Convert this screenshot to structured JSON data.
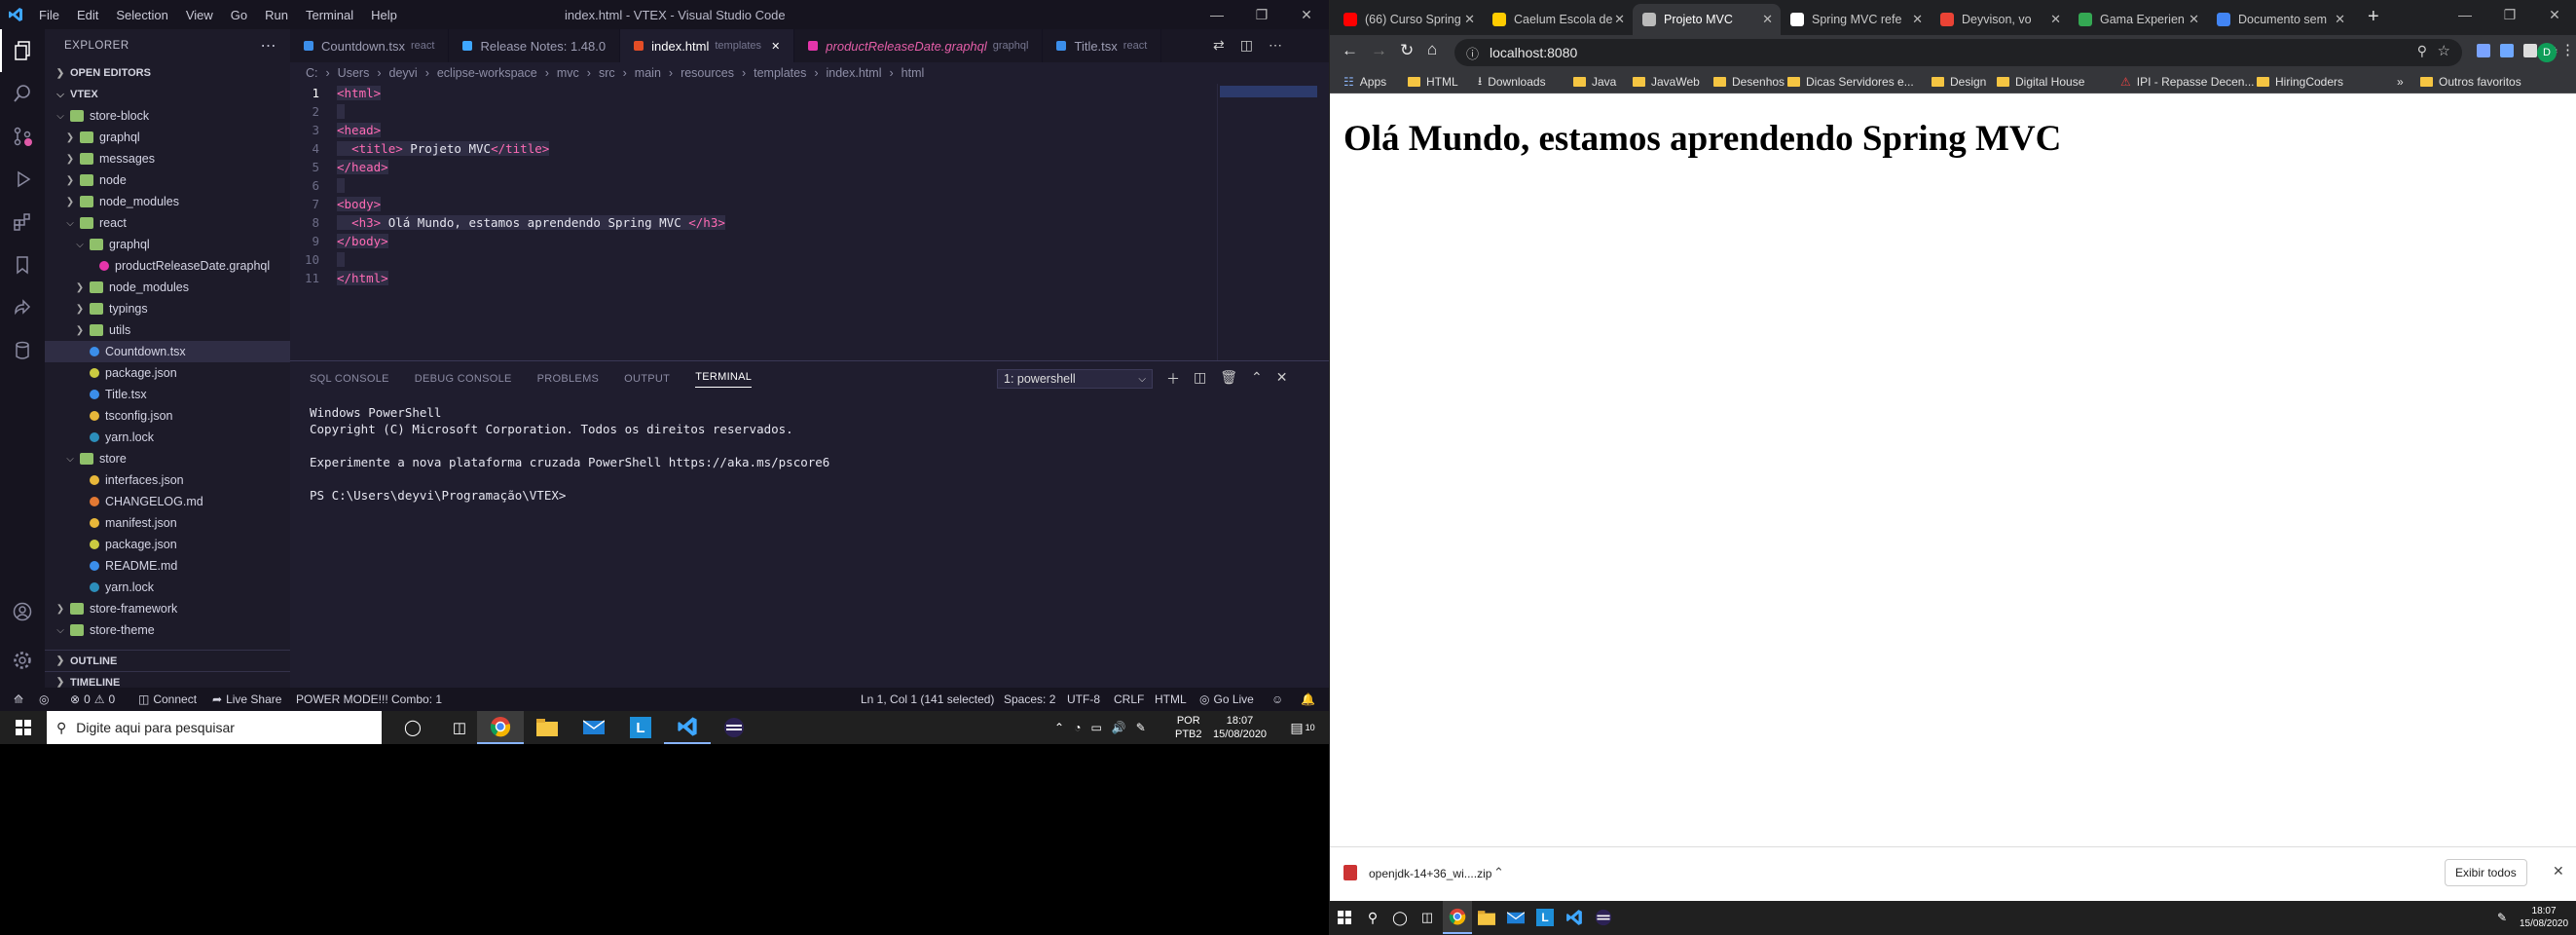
{
  "vscode": {
    "window_title": "index.html - VTEX - Visual Studio Code",
    "menu": [
      "File",
      "Edit",
      "Selection",
      "View",
      "Go",
      "Run",
      "Terminal",
      "Help"
    ],
    "explorer_title": "EXPLORER",
    "sections": {
      "open_editors": "OPEN EDITORS",
      "root": "VTEX",
      "outline": "OUTLINE",
      "timeline": "TIMELINE"
    },
    "tree": [
      {
        "label": "store-block",
        "depth": 0,
        "type": "folder-open"
      },
      {
        "label": "graphql",
        "depth": 1,
        "type": "folder"
      },
      {
        "label": "messages",
        "depth": 1,
        "type": "folder"
      },
      {
        "label": "node",
        "depth": 1,
        "type": "folder"
      },
      {
        "label": "node_modules",
        "depth": 1,
        "type": "folder"
      },
      {
        "label": "react",
        "depth": 1,
        "type": "folder-open"
      },
      {
        "label": "graphql",
        "depth": 2,
        "type": "folder-open"
      },
      {
        "label": "productReleaseDate.graphql",
        "depth": 3,
        "type": "graphql"
      },
      {
        "label": "node_modules",
        "depth": 2,
        "type": "folder"
      },
      {
        "label": "typings",
        "depth": 2,
        "type": "folder"
      },
      {
        "label": "utils",
        "depth": 2,
        "type": "folder"
      },
      {
        "label": "Countdown.tsx",
        "depth": 2,
        "type": "tsx",
        "selected": true
      },
      {
        "label": "package.json",
        "depth": 2,
        "type": "json"
      },
      {
        "label": "Title.tsx",
        "depth": 2,
        "type": "tsx"
      },
      {
        "label": "tsconfig.json",
        "depth": 2,
        "type": "config"
      },
      {
        "label": "yarn.lock",
        "depth": 2,
        "type": "yarn"
      },
      {
        "label": "store",
        "depth": 1,
        "type": "folder-open"
      },
      {
        "label": "interfaces.json",
        "depth": 2,
        "type": "config"
      },
      {
        "label": "CHANGELOG.md",
        "depth": 2,
        "type": "md"
      },
      {
        "label": "manifest.json",
        "depth": 2,
        "type": "config"
      },
      {
        "label": "package.json",
        "depth": 2,
        "type": "json"
      },
      {
        "label": "README.md",
        "depth": 2,
        "type": "info"
      },
      {
        "label": "yarn.lock",
        "depth": 2,
        "type": "yarn"
      },
      {
        "label": "store-framework",
        "depth": 0,
        "type": "folder"
      },
      {
        "label": "store-theme",
        "depth": 0,
        "type": "folder-open"
      }
    ],
    "tabs": [
      {
        "label": "Countdown.tsx",
        "sub": "react",
        "active": false
      },
      {
        "label": "Release Notes: 1.48.0",
        "sub": "",
        "active": false
      },
      {
        "label": "index.html",
        "sub": "templates",
        "active": true
      },
      {
        "label": "productReleaseDate.graphql",
        "sub": "graphql",
        "active": false
      },
      {
        "label": "Title.tsx",
        "sub": "react",
        "active": false
      }
    ],
    "breadcrumb": [
      "C:",
      "Users",
      "deyvi",
      "eclipse-workspace",
      "mvc",
      "src",
      "main",
      "resources",
      "templates",
      "index.html",
      "html"
    ],
    "code": [
      "<html>",
      "",
      "<head>",
      "  <title> Projeto MVC</title>",
      "</head>",
      "",
      "<body>",
      "  <h3> Olá Mundo, estamos aprendendo Spring MVC </h3>",
      "</body>",
      "",
      "</html>"
    ],
    "panel_tabs": [
      "SQL CONSOLE",
      "DEBUG CONSOLE",
      "PROBLEMS",
      "OUTPUT",
      "TERMINAL"
    ],
    "terminal_select": "1: powershell",
    "terminal_text": "Windows PowerShell\nCopyright (C) Microsoft Corporation. Todos os direitos reservados.\n\nExperimente a nova plataforma cruzada PowerShell https://aka.ms/pscore6\n\nPS C:\\Users\\deyvi\\Programação\\VTEX>",
    "status": {
      "errors": "0",
      "warnings": "0",
      "connect": "Connect",
      "live_share": "Live Share",
      "power_mode": "POWER MODE!!! Combo: 1",
      "position": "Ln 1, Col 1 (141 selected)",
      "spaces": "Spaces: 2",
      "encoding": "UTF-8",
      "eol": "CRLF",
      "language": "HTML",
      "go_live": "Go Live"
    }
  },
  "taskbar": {
    "search_placeholder": "Digite aqui para pesquisar",
    "lang": "POR",
    "layout": "PTB2",
    "time": "18:07",
    "date": "15/08/2020",
    "notif": "10"
  },
  "chrome": {
    "tabs": [
      {
        "label": "(66) Curso Spring",
        "color": "#ff0000"
      },
      {
        "label": "Caelum Escola de",
        "color": "#ffcc00"
      },
      {
        "label": "Projeto MVC",
        "color": "#bbbbbb",
        "active": true
      },
      {
        "label": "Spring MVC refe",
        "color": "#ffffff"
      },
      {
        "label": "Deyvison, vo",
        "color": "#ea4335"
      },
      {
        "label": "Gama Experien",
        "color": "#34a853"
      },
      {
        "label": "Documento sem",
        "color": "#4285f4"
      }
    ],
    "url": "localhost:8080",
    "bookmarks": [
      "Apps",
      "HTML",
      "Downloads",
      "Java",
      "JavaWeb",
      "Desenhos",
      "Dicas Servidores e...",
      "Design",
      "Digital House",
      "IPI - Repasse Decen...",
      "HiringCoders",
      "Outros favoritos"
    ],
    "page_heading": "Olá Mundo, estamos aprendendo Spring MVC",
    "download_file": "openjdk-14+36_wi....zip",
    "show_all": "Exibir todos",
    "profile_initial": "D"
  },
  "taskbar2": {
    "time": "18:07",
    "date": "15/08/2020"
  }
}
